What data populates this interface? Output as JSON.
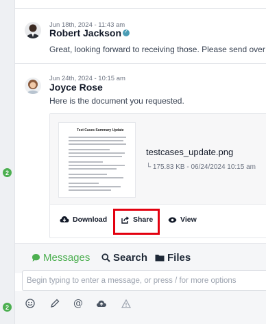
{
  "rail": {
    "badges": [
      "2",
      "2"
    ]
  },
  "messages": [
    {
      "meta": "Jun 18th, 2024 - 11:43 am",
      "author": "Robert Jackson",
      "text": "Great, looking forward to receiving those. Please send over"
    },
    {
      "meta": "Jun 24th, 2024 - 10:15 am",
      "author": "Joyce Rose",
      "text": "Here is the document you requested."
    }
  ],
  "attachment": {
    "file_name": "testcases_update.png",
    "file_info": "└ 175.83 KB - 06/24/2024 10:15 am",
    "thumb_title": "Test Cases Summary Update",
    "actions": {
      "download": "Download",
      "share": "Share",
      "view": "View"
    }
  },
  "tabs": [
    {
      "label": "Messages",
      "icon": "chat-icon",
      "active": true
    },
    {
      "label": "Search",
      "icon": "search-icon",
      "active": false
    },
    {
      "label": "Files",
      "icon": "folder-icon",
      "active": false
    }
  ],
  "composer": {
    "placeholder": "Begin typing to enter a message, or press / for more options"
  },
  "toolbar": {
    "icons": [
      "emoji-icon",
      "pen-icon",
      "mention-icon",
      "cloud-upload-icon",
      "warning-icon"
    ]
  },
  "colors": {
    "accent": "#4caf50",
    "highlight": "#e3000f",
    "verified": "#4a9db5"
  }
}
